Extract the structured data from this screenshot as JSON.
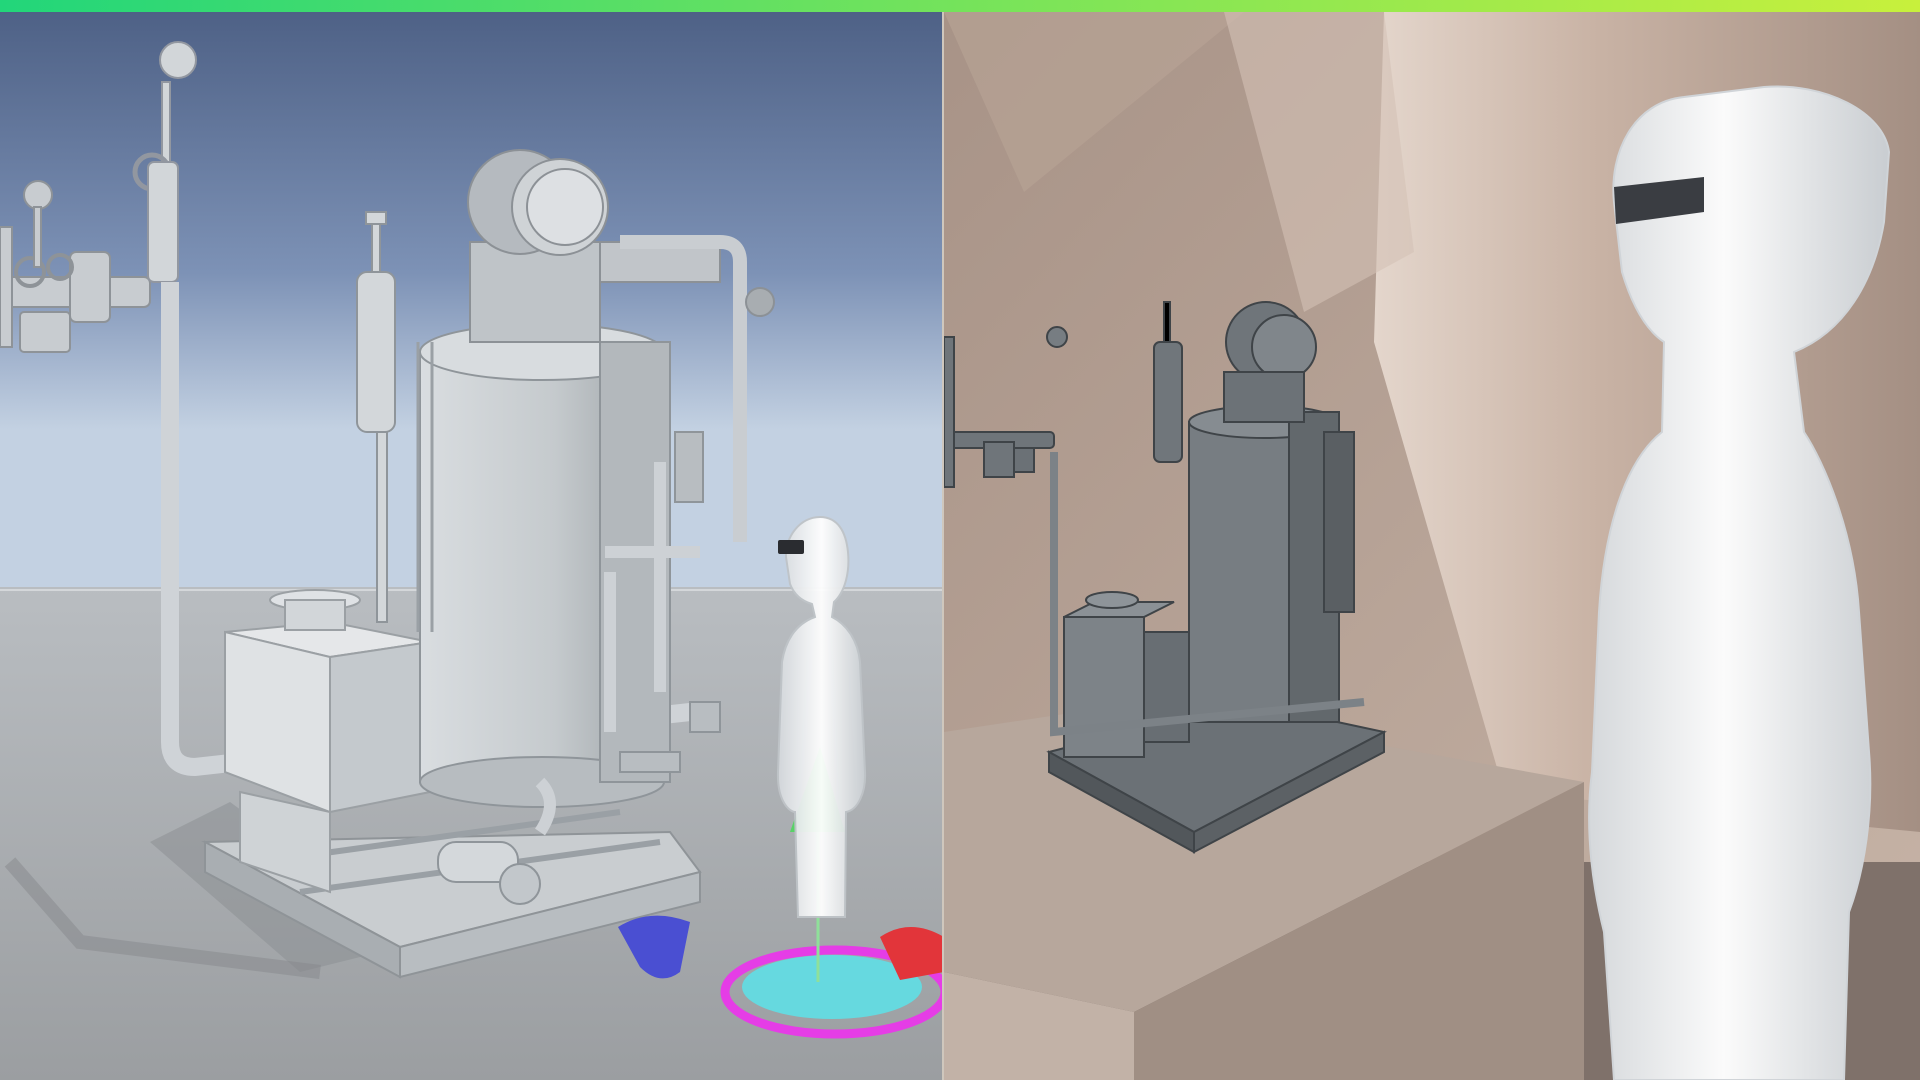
{
  "accent": {
    "gradient_start": "#22d67a",
    "gradient_end": "#c8f03c"
  },
  "panels": [
    {
      "id": "unity-editor-view",
      "description_colors": {
        "sky_top": "#4f6488",
        "sky_bottom": "#c3d2e4",
        "ground": "#a9acaf"
      }
    },
    {
      "id": "mixed-reality-view",
      "description_colors": {
        "wall": "#c9b6a8",
        "pedestal": "#b6a69b",
        "floor": "#8a7c72"
      }
    }
  ],
  "gizmo": {
    "x_axis_color": "#e2353a",
    "y_axis_color": "#4fd35f",
    "z_axis_color": "#4a4fd0",
    "ring_color": "#e23de4",
    "disc_color": "#5fe0e6"
  },
  "icons": [
    "boiler-model",
    "avatar-figure",
    "vr-headset",
    "transform-gizmo"
  ]
}
